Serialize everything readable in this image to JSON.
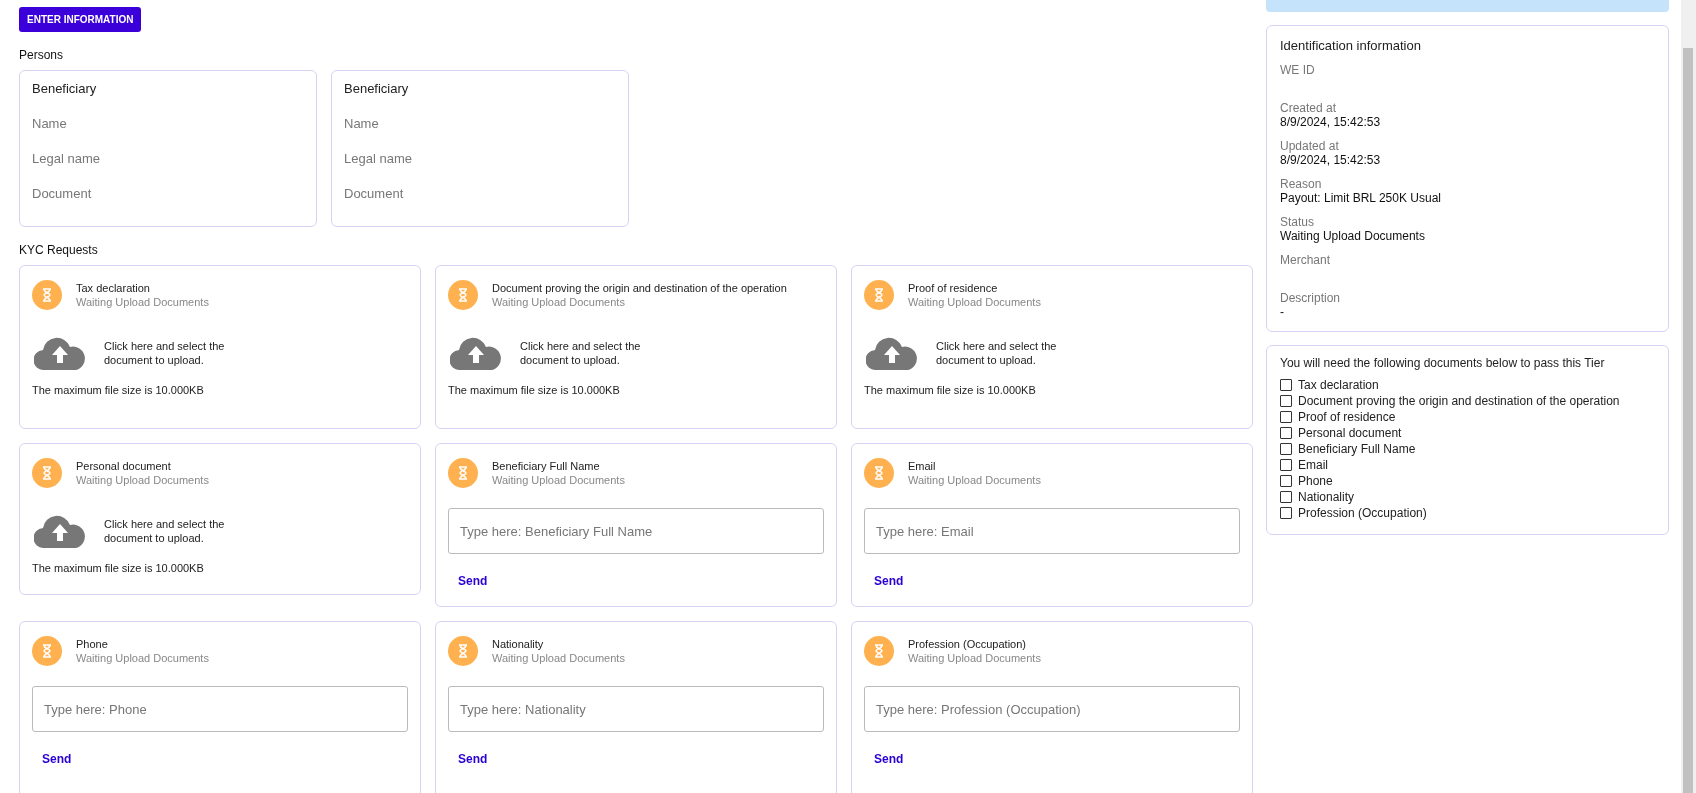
{
  "enter_button": "ENTER INFORMATION",
  "persons": {
    "title": "Persons",
    "cards": [
      {
        "title": "Beneficiary",
        "fields": [
          "Name",
          "Legal name",
          "Document"
        ]
      },
      {
        "title": "Beneficiary",
        "fields": [
          "Name",
          "Legal name",
          "Document"
        ]
      }
    ]
  },
  "kyc": {
    "title": "KYC Requests",
    "requests": [
      {
        "kind": "upload",
        "name": "Tax declaration",
        "status": "Waiting Upload Documents",
        "upload_text": "Click here and select the document to upload.",
        "limit": "The maximum file size is 10.000KB"
      },
      {
        "kind": "upload",
        "name": "Document proving the origin and destination of the operation",
        "status": "Waiting Upload Documents",
        "upload_text": "Click here and select the document to upload.",
        "limit": "The maximum file size is 10.000KB"
      },
      {
        "kind": "upload",
        "name": "Proof of residence",
        "status": "Waiting Upload Documents",
        "upload_text": "Click here and select the document to upload.",
        "limit": "The maximum file size is 10.000KB"
      },
      {
        "kind": "upload",
        "name": "Personal document",
        "status": "Waiting Upload Documents",
        "upload_text": "Click here and select the document to upload.",
        "limit": "The maximum file size is 10.000KB"
      },
      {
        "kind": "text",
        "name": "Beneficiary Full Name",
        "status": "Waiting Upload Documents",
        "placeholder": "Type here: Beneficiary Full Name",
        "send": "Send"
      },
      {
        "kind": "text",
        "name": "Email",
        "status": "Waiting Upload Documents",
        "placeholder": "Type here: Email",
        "send": "Send"
      },
      {
        "kind": "text",
        "name": "Phone",
        "status": "Waiting Upload Documents",
        "placeholder": "Type here: Phone",
        "send": "Send"
      },
      {
        "kind": "text",
        "name": "Nationality",
        "status": "Waiting Upload Documents",
        "placeholder": "Type here: Nationality",
        "send": "Send"
      },
      {
        "kind": "text",
        "name": "Profession (Occupation)",
        "status": "Waiting Upload Documents",
        "placeholder": "Type here: Profession (Occupation)",
        "send": "Send"
      }
    ]
  },
  "identification": {
    "title": "Identification information",
    "fields": [
      {
        "label": "WE ID"
      },
      {
        "label": "Created at",
        "value": "8/9/2024, 15:42:53"
      },
      {
        "label": "Updated at",
        "value": "8/9/2024, 15:42:53"
      },
      {
        "label": "Reason",
        "value": "Payout: Limit BRL 250K Usual"
      },
      {
        "label": "Status",
        "value": "Waiting Upload Documents"
      },
      {
        "label": "Merchant"
      },
      {
        "label": "Description",
        "value": "-"
      }
    ]
  },
  "checklist": {
    "title": "You will need the following documents below to pass this Tier",
    "items": [
      {
        "label": "Tax declaration",
        "checked": false
      },
      {
        "label": "Document proving the origin and destination of the operation",
        "checked": false
      },
      {
        "label": "Proof of residence",
        "checked": false
      },
      {
        "label": "Personal document",
        "checked": false
      },
      {
        "label": "Beneficiary Full Name",
        "checked": false
      },
      {
        "label": "Email",
        "checked": false
      },
      {
        "label": "Phone",
        "checked": false
      },
      {
        "label": "Nationality",
        "checked": false
      },
      {
        "label": "Profession (Occupation)",
        "checked": false
      }
    ]
  }
}
